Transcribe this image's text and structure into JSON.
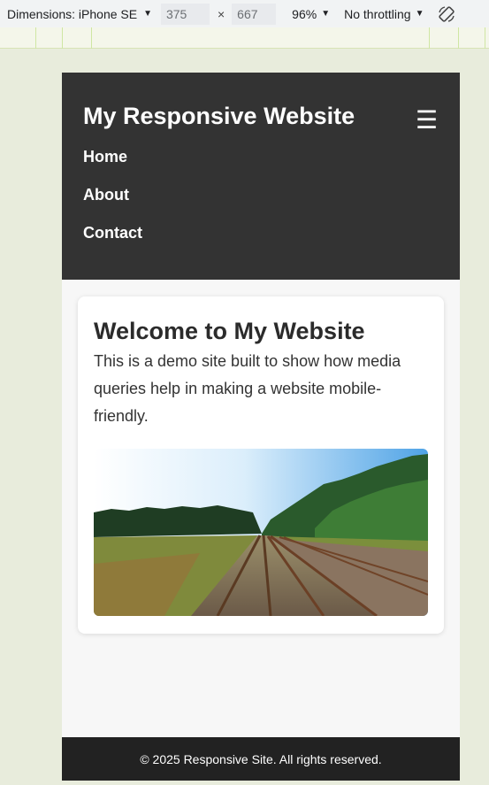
{
  "devtools": {
    "dimensions_label": "Dimensions: iPhone SE",
    "width": "375",
    "times": "×",
    "height": "667",
    "zoom": "96%",
    "throttling": "No throttling",
    "rotate_icon": "rotate-icon"
  },
  "site": {
    "title": "My Responsive Website",
    "menu_icon": "☰",
    "nav": [
      {
        "label": "Home"
      },
      {
        "label": "About"
      },
      {
        "label": "Contact"
      }
    ]
  },
  "main": {
    "heading": "Welcome to My Website",
    "text": "This is a demo site built to show how media queries help in making a website mobile-friendly.",
    "image": "railway-tracks-landscape"
  },
  "footer": {
    "text": "© 2025 Responsive Site. All rights reserved."
  }
}
